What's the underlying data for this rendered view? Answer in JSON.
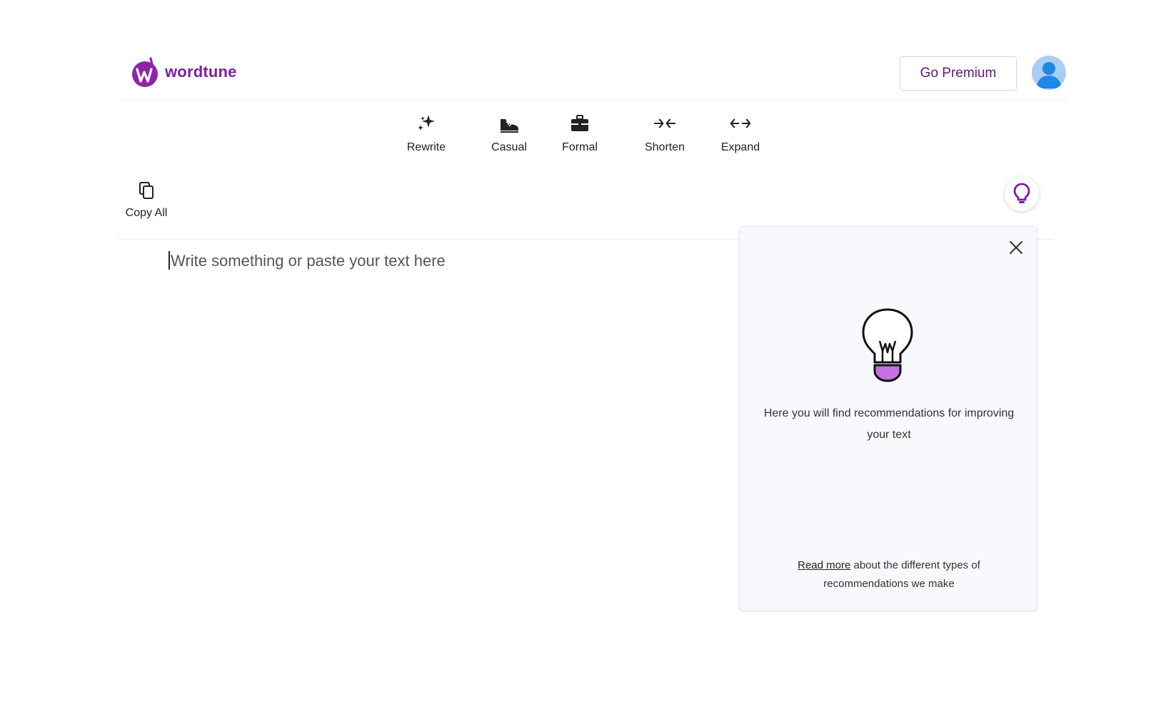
{
  "header": {
    "logo_text": "wordtune",
    "premium_label": "Go Premium"
  },
  "toolbar": {
    "items": [
      {
        "label": "Rewrite",
        "icon": "sparkles-icon"
      },
      {
        "label": "Casual",
        "icon": "sneaker-icon"
      },
      {
        "label": "Formal",
        "icon": "briefcase-icon"
      },
      {
        "label": "Shorten",
        "icon": "arrows-inward-icon"
      },
      {
        "label": "Expand",
        "icon": "arrows-outward-icon"
      }
    ]
  },
  "actions": {
    "copy_all_label": "Copy All"
  },
  "editor": {
    "placeholder": "Write something or paste your text here"
  },
  "panel": {
    "message": "Here you will find recommendations for improving your text",
    "footer_link": "Read more",
    "footer_text": " about the different types of recommendations we make"
  },
  "colors": {
    "brand": "#7b1fa2",
    "panel_bg": "#f8f9fc",
    "avatar_bg": "#a9cdf5"
  }
}
